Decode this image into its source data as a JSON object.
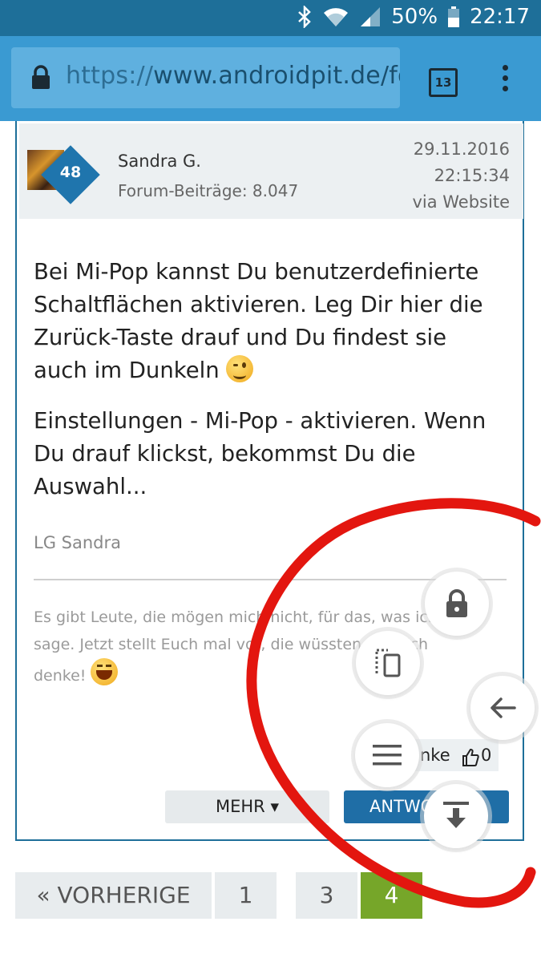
{
  "status_bar": {
    "battery": "50%",
    "time": "22:17",
    "icons": [
      "bluetooth-icon",
      "wifi-icon",
      "signal-icon",
      "battery-icon"
    ]
  },
  "browser": {
    "url_protocol": "https://",
    "url_host": "www.androidpit.de/foru",
    "tab_count": "13"
  },
  "post": {
    "author": "Sandra G.",
    "rank": "48",
    "forum_posts": "Forum-Beiträge: 8.047",
    "date": "29.11.2016",
    "time": "22:15:34",
    "via": "via Website",
    "paragraph1": "Bei Mi-Pop kannst Du benutzerdefinierte Schaltflächen aktivieren. Leg Dir hier die Zurück-Taste drauf und Du findest sie auch im Dunkeln",
    "paragraph2": "Einstellungen - Mi-Pop - aktivieren. Wenn Du drauf klickst, bekommst Du die Auswahl...",
    "signoff": "LG Sandra",
    "signature": "Es gibt Leute, die mögen mich nicht, für das, was ich sage. Jetzt stellt Euch mal vor, die wüssten, was ich denke!",
    "like_label": "nke",
    "like_count": "0",
    "more_button": "MEHR ▾",
    "reply_button": "ANTWO"
  },
  "pagination": {
    "prev": "« VORHERIGE",
    "pages": [
      "1",
      "3",
      "4"
    ],
    "active": "4"
  },
  "floating_buttons": [
    "lock-icon",
    "screenshot-icon",
    "back-arrow-icon",
    "menu-icon",
    "scroll-bottom-icon"
  ],
  "colors": {
    "status_bar": "#1e6f99",
    "toolbar": "#3a9ad2",
    "accent": "#1f6ea6",
    "active_page": "#76a629",
    "annotation": "#e3160f"
  }
}
